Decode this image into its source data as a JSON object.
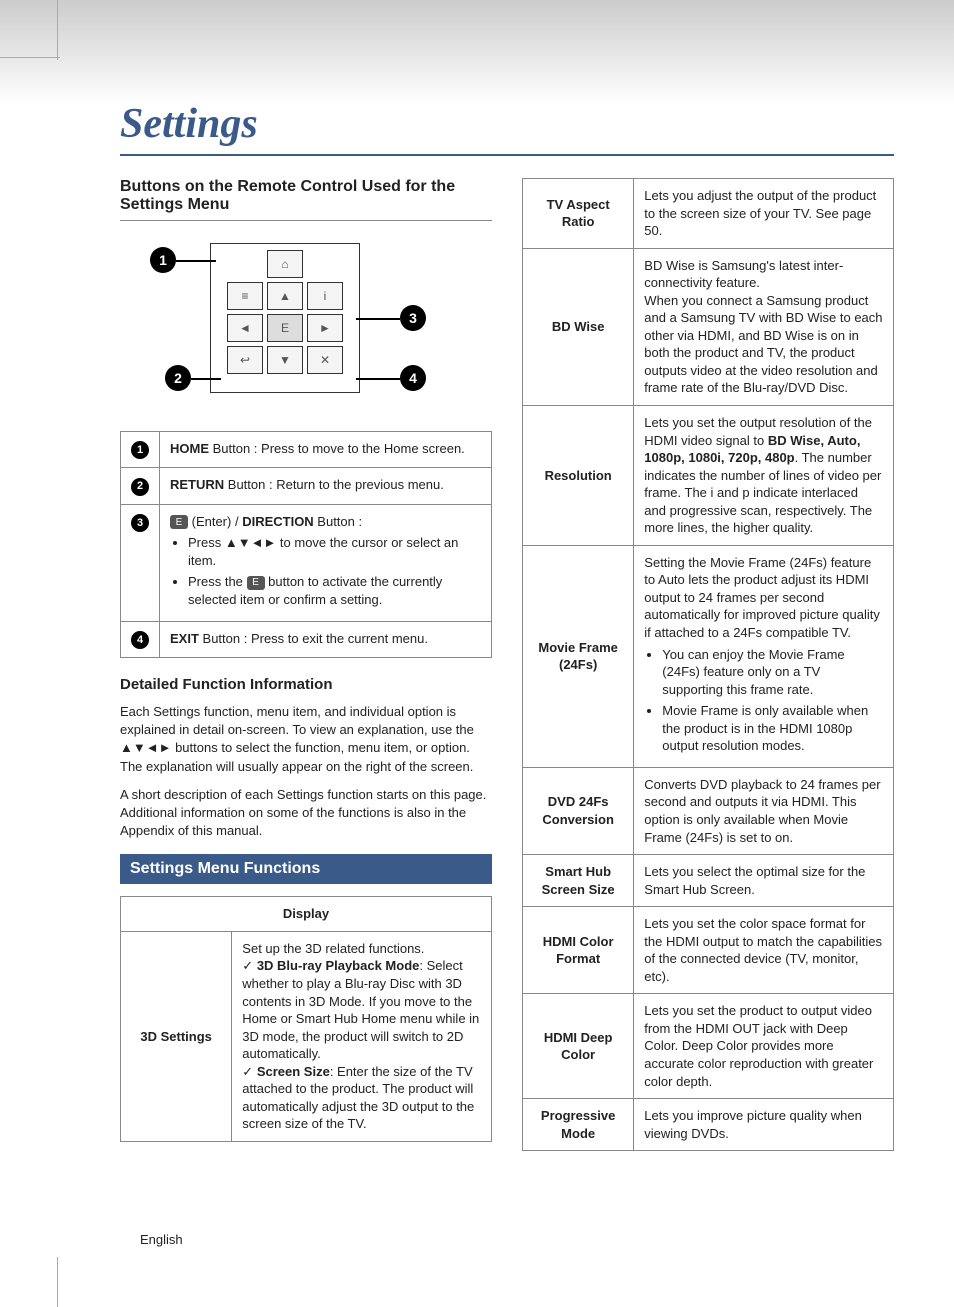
{
  "title": "Settings",
  "left": {
    "heading": "Buttons on the Remote Control Used for the Settings Menu",
    "callouts": [
      "1",
      "2",
      "3",
      "4"
    ],
    "buttons_table": [
      {
        "num": "1",
        "html": "<b>HOME</b> Button : Press to move to the Home screen."
      },
      {
        "num": "2",
        "html": "<b>RETURN</b> Button : Return to the previous menu."
      },
      {
        "num": "3",
        "html": "<span class='enter-chip'>E</span> (Enter) / <b>DIRECTION</b> Button :<ul class='inner'><li>Press <span class='arrows'>▲▼◄►</span> to move the cursor or select an item.</li><li>Press the <span class='enter-chip'>E</span> button to activate the currently selected item or confirm a setting.</li></ul>"
      },
      {
        "num": "4",
        "html": "<b>EXIT</b> Button : Press to exit the current menu."
      }
    ],
    "detail_heading": "Detailed Function Information",
    "detail_p1": "Each Settings function, menu item, and individual option is explained in detail on-screen. To view an explanation, use the ▲▼◄► buttons to select the function, menu item, or option. The explanation will usually appear on the right of the screen.",
    "detail_p2": "A short description of each Settings function starts on this page. Additional information on some of the functions is also in the Appendix of this manual.",
    "menu_heading": "Settings Menu Functions",
    "display_header": "Display",
    "display_rows": [
      {
        "label": "3D Settings",
        "html": "Set up the 3D related functions.<div class='check'><b>3D Blu-ray Playback Mode</b>: Select whether to play a Blu-ray Disc with 3D contents in 3D Mode. If you move to the Home or Smart Hub Home menu while in 3D mode, the product will switch to 2D automatically.</div><div class='check'><b>Screen Size</b>: Enter the size of the TV attached to the product. The product will automatically adjust the 3D output to the screen size of the TV.</div>"
      }
    ]
  },
  "right_rows": [
    {
      "label": "TV Aspect Ratio",
      "html": "Lets you adjust the output of the product to the screen size of your TV. See page 50."
    },
    {
      "label": "BD Wise",
      "html": "BD Wise is Samsung's latest inter-connectivity feature.<br>When you connect a Samsung product and a Samsung TV with BD Wise to each other via HDMI, and BD Wise is on in both the product and TV, the product outputs video at the video resolution and frame rate of the Blu-ray/DVD Disc."
    },
    {
      "label": "Resolution",
      "html": "Lets you set the output resolution of the HDMI video signal to <b>BD Wise, Auto, 1080p, 1080i, 720p, 480p</b>. The number indicates the number of lines of video per frame. The i and p indicate interlaced and progressive scan, respectively. The more lines, the higher quality."
    },
    {
      "label": "Movie Frame (24Fs)",
      "html": "Setting the Movie Frame (24Fs) feature to Auto lets the product adjust its HDMI output to 24 frames per second automatically for improved picture quality if attached to a 24Fs compatible TV.<ul class='inner'><li>You can enjoy the Movie Frame (24Fs) feature only on a TV supporting this frame rate.</li><li>Movie Frame is only available when the product is in the HDMI 1080p output resolution modes.</li></ul>"
    },
    {
      "label": "DVD 24Fs Conversion",
      "html": "Converts DVD playback to 24 frames per second and outputs it via HDMI. This option is only available when Movie Frame (24Fs) is set to on."
    },
    {
      "label": "Smart Hub Screen Size",
      "html": "Lets you select the optimal size for the Smart Hub Screen."
    },
    {
      "label": "HDMI Color Format",
      "html": "Lets you set the color space format for the HDMI output to match the capabilities of the connected device (TV, monitor, etc)."
    },
    {
      "label": "HDMI Deep Color",
      "html": "Lets you set the product to output video from the HDMI OUT jack with Deep Color. Deep Color provides more accurate color reproduction with greater color depth."
    },
    {
      "label": "Progressive Mode",
      "html": "Lets you improve picture quality when viewing DVDs."
    }
  ],
  "footer": "English"
}
